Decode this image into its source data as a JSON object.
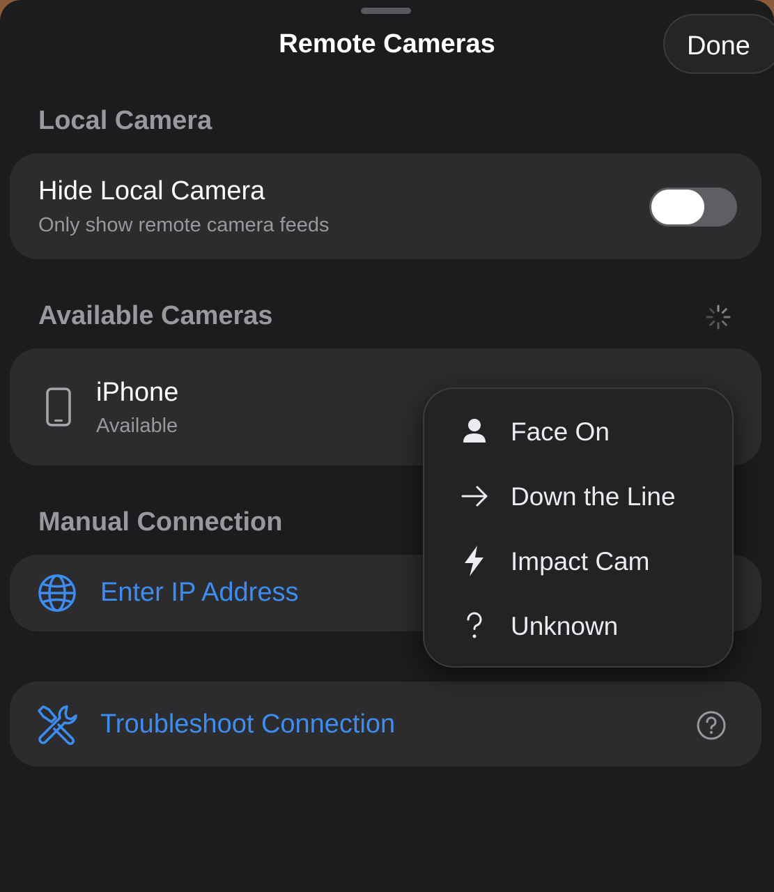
{
  "header": {
    "title": "Remote Cameras",
    "done_label": "Done"
  },
  "local_camera": {
    "heading": "Local Camera",
    "hide_title": "Hide Local Camera",
    "hide_subtitle": "Only show remote camera feeds",
    "toggle_on": false
  },
  "available_cameras": {
    "heading": "Available Cameras",
    "devices": [
      {
        "name": "iPhone",
        "status": "Available",
        "icon": "iphone-icon"
      }
    ]
  },
  "manual_connection": {
    "heading": "Manual Connection",
    "enter_ip_label": "Enter IP Address"
  },
  "troubleshoot": {
    "label": "Troubleshoot Connection"
  },
  "angle_menu": {
    "items": [
      {
        "label": "Face On",
        "icon": "person-icon"
      },
      {
        "label": "Down the Line",
        "icon": "arrow-right-icon"
      },
      {
        "label": "Impact Cam",
        "icon": "bolt-icon"
      },
      {
        "label": "Unknown",
        "icon": "question-mark-icon"
      }
    ]
  },
  "colors": {
    "accent": "#3d8cf0",
    "background": "#1c1c1e",
    "card": "#2c2c2e",
    "secondary_text": "#98989d"
  }
}
